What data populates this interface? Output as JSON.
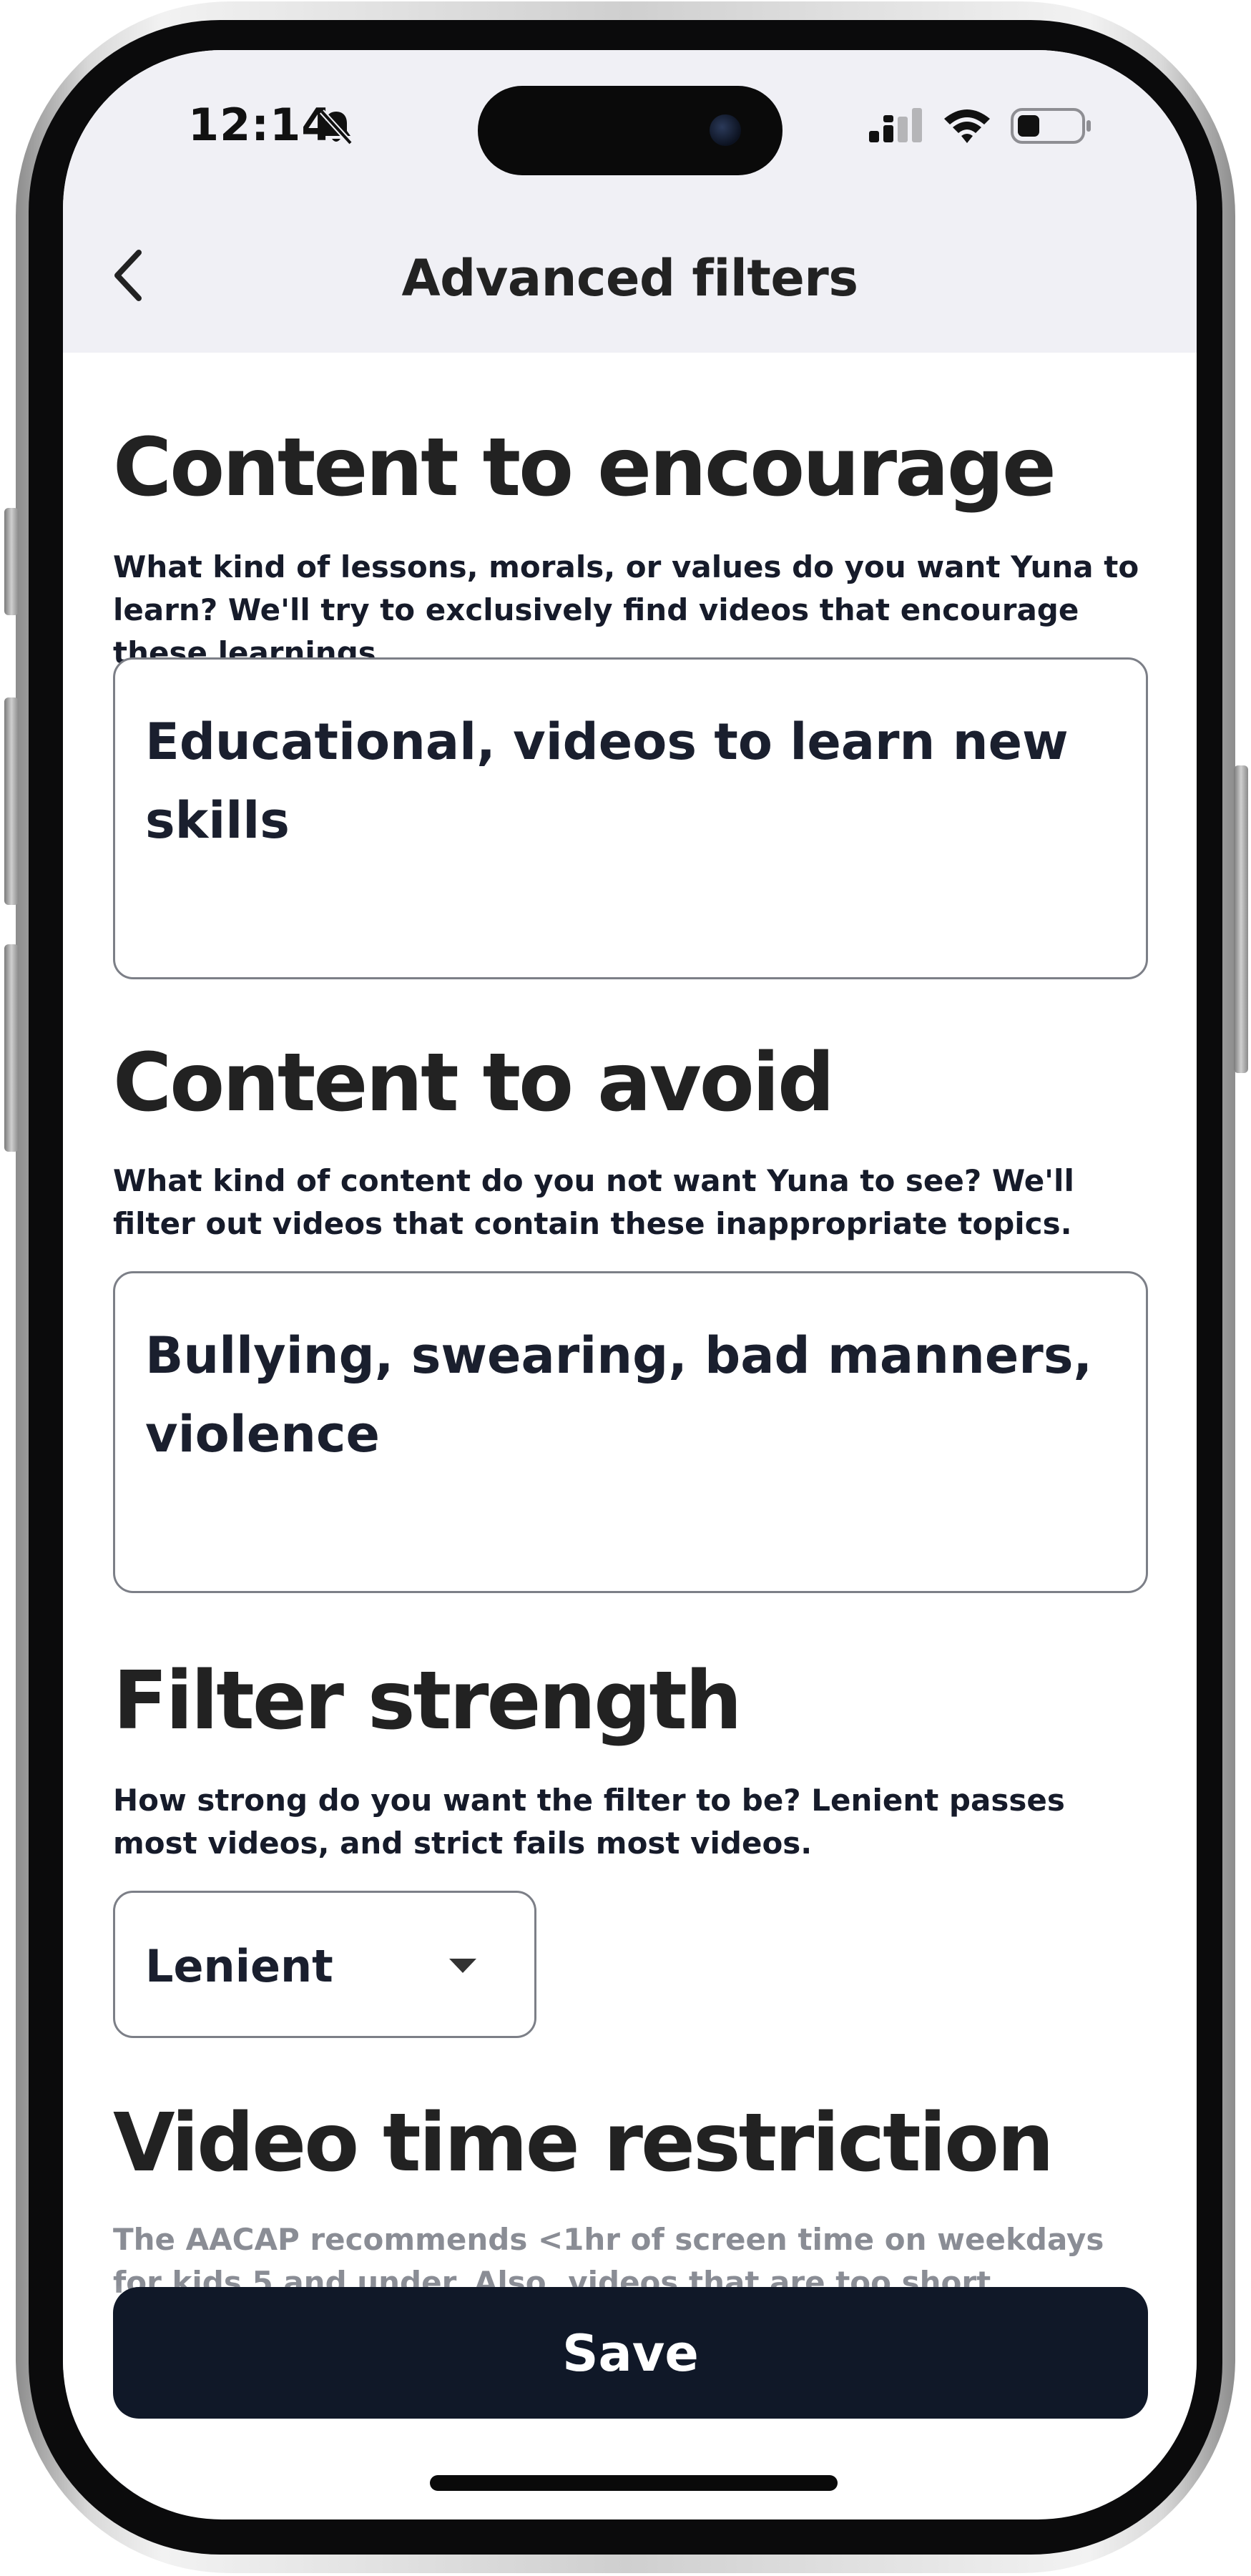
{
  "status_bar": {
    "time": "12:14"
  },
  "header": {
    "title": "Advanced filters"
  },
  "sections": {
    "encourage": {
      "title": "Content to encourage",
      "description": "What kind of lessons, morals, or values do you want Yuna to learn? We'll try to exclusively find videos that encourage these learnings.",
      "value": "Educational, videos to learn new skills"
    },
    "avoid": {
      "title": "Content to avoid",
      "description": "What kind of content do you not want Yuna to see? We'll filter out videos that contain these inappropriate topics.",
      "value": "Bullying, swearing, bad manners, violence"
    },
    "strength": {
      "title": "Filter strength",
      "description": "How strong do you want the filter to be? Lenient passes most videos, and strict fails most videos.",
      "selected": "Lenient"
    },
    "time_restriction": {
      "title": "Video time restriction",
      "description": "The AACAP recommends <1hr of screen time on weekdays for kids 5 and under. Also, videos that are too short encourage video-jumping,"
    }
  },
  "save_label": "Save",
  "colors": {
    "header_bg": "#f0f0f5",
    "button_bg": "#101828",
    "text_dark": "#1a1f2e"
  }
}
